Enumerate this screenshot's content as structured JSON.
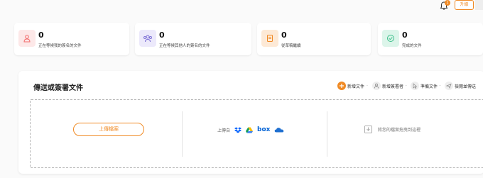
{
  "header": {
    "notification_count": "1",
    "upgrade_label": "升級"
  },
  "cards": [
    {
      "count": "0",
      "label": "正在等候我的簽名的文件",
      "icon": "person-icon",
      "color": "#f26b6b",
      "bg": "#fde8e8"
    },
    {
      "count": "0",
      "label": "正在等候其他人的簽名的文件",
      "icon": "people-icon",
      "color": "#7c6fd6",
      "bg": "#ece9fb"
    },
    {
      "count": "0",
      "label": "從草稿繼續",
      "icon": "draft-icon",
      "color": "#f08a24",
      "bg": "#fde9d6"
    },
    {
      "count": "0",
      "label": "完成的文件",
      "icon": "check-circle-icon",
      "color": "#3bbf8a",
      "bg": "#dcf5ea"
    }
  ],
  "panel": {
    "title": "傳送或簽署文件",
    "steps": [
      "新增文件",
      "新增簽署者",
      "準備文件",
      "檢閱並傳送"
    ],
    "upload_label": "上傳檔案",
    "upload_from_label": "上傳自",
    "services": [
      "dropbox-icon",
      "google-drive-icon",
      "box-icon",
      "onedrive-icon"
    ],
    "box_text": "box",
    "drag_label": "將您的檔案拖曳到這裡"
  },
  "colors": {
    "accent": "#f08a24"
  }
}
